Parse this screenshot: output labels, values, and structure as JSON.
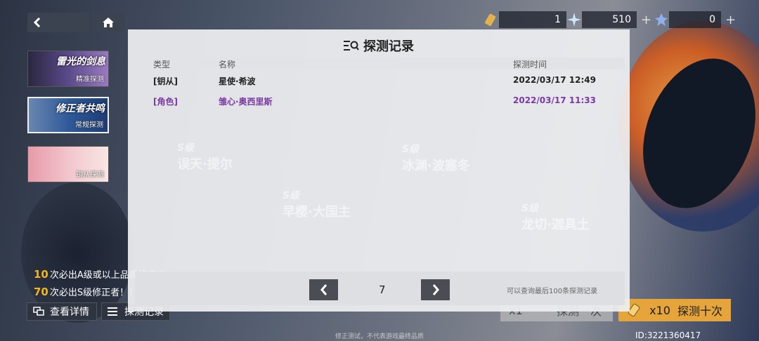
{
  "resources": [
    {
      "icon": "ticket-icon",
      "value": "1",
      "has_plus": false
    },
    {
      "icon": "crystal-icon",
      "value": "510",
      "has_plus": true
    },
    {
      "icon": "star-shard-icon",
      "value": "0",
      "has_plus": true
    }
  ],
  "banners": [
    {
      "title": "雷光的剑息",
      "sub": "精准探测",
      "selected": false
    },
    {
      "title": "修正者共鸣",
      "sub": "常规探测",
      "selected": true
    },
    {
      "title": "",
      "sub": "钥从探测",
      "selected": false
    }
  ],
  "hints": [
    {
      "num": "10",
      "text": "次必出A级或以上品质修正者！"
    },
    {
      "num": "70",
      "text": "次必出S级修正者！！"
    }
  ],
  "bottom_buttons": {
    "details": "查看详情",
    "records": "探测记录"
  },
  "draw": {
    "single_count": "x1",
    "single_label": "探测一次",
    "ten_count": "x10",
    "ten_label": "探测十次"
  },
  "footer_note": "修正测试，不代表游戏最终品质",
  "uid": "ID:3221360417",
  "background_labels": [
    {
      "grade": "S级",
      "name": "误天·提尔"
    },
    {
      "grade": "S级",
      "name": "冰渊·波塞冬"
    },
    {
      "grade": "S级",
      "name": "早樱·大国主"
    },
    {
      "grade": "S级",
      "name": "龙切·迦具土"
    }
  ],
  "modal": {
    "title": "探测记录",
    "columns": {
      "type": "类型",
      "name": "名称",
      "time": "探测时间"
    },
    "rows": [
      {
        "type": "[钥从]",
        "name": "星使·希波",
        "time": "2022/03/17 12:49",
        "kind": "key"
      },
      {
        "type": "[角色]",
        "name": "雏心·奥西里斯",
        "time": "2022/03/17 11:33",
        "kind": "char"
      }
    ],
    "page": "7",
    "note": "可以查询最后100条探测记录"
  },
  "colors": {
    "accent_gold": "#f2b51d",
    "character_purple": "#7a3aa3",
    "draw_ten_bg": "#e6a53a"
  }
}
